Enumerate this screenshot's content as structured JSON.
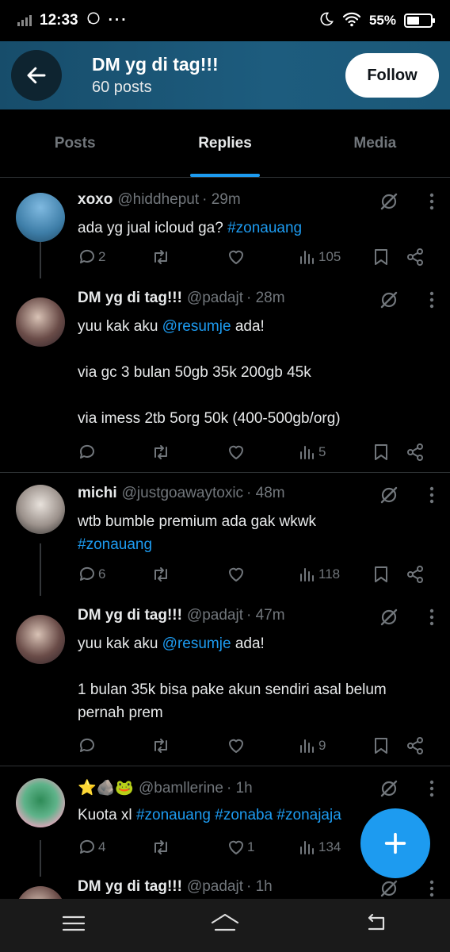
{
  "status": {
    "time": "12:33",
    "dots": "···",
    "battery": "55%",
    "battery_fraction": 0.55
  },
  "header": {
    "title": "DM yg di tag!!!",
    "subtitle": "60 posts",
    "follow_label": "Follow"
  },
  "tabs": [
    {
      "label": "Posts"
    },
    {
      "label": "Replies"
    },
    {
      "label": "Media"
    }
  ],
  "active_tab": "Replies",
  "tweets": [
    {
      "name": "xoxo",
      "handle": "@hiddheput",
      "time": "· 29m",
      "body": [
        {
          "t": "ada yg jual icloud ga? "
        },
        {
          "t": "#zonauang",
          "link": true
        }
      ],
      "replies": "2",
      "retweets": "",
      "likes": "",
      "views": "105"
    },
    {
      "name": "DM yg di tag!!!",
      "handle": "@padajt",
      "time": "· 28m",
      "body": [
        {
          "t": "yuu kak aku "
        },
        {
          "t": "@resumje",
          "link": true
        },
        {
          "t": " ada!\n\nvia gc 3 bulan 50gb 35k 200gb 45k\n\nvia imess 2tb 5org 50k (400-500gb/org)"
        }
      ],
      "replies": "",
      "retweets": "",
      "likes": "",
      "views": "5"
    },
    {
      "name": "michi",
      "handle": "@justgoawaytoxic",
      "time": "· 48m",
      "body": [
        {
          "t": "wtb bumble premium ada gak wkwk\n"
        },
        {
          "t": "#zonauang",
          "link": true
        }
      ],
      "replies": "6",
      "retweets": "",
      "likes": "",
      "views": "118"
    },
    {
      "name": "DM yg di tag!!!",
      "handle": "@padajt",
      "time": "· 47m",
      "body": [
        {
          "t": "yuu kak aku "
        },
        {
          "t": "@resumje",
          "link": true
        },
        {
          "t": " ada!\n\n1 bulan 35k bisa pake akun sendiri asal belum pernah prem"
        }
      ],
      "replies": "",
      "retweets": "",
      "likes": "",
      "views": "9"
    },
    {
      "name": "⭐🪨🐸",
      "handle": "@bamllerine",
      "time": "· 1h",
      "body": [
        {
          "t": "Kuota xl "
        },
        {
          "t": "#zonauang #zonaba #zonajaja",
          "link": true
        }
      ],
      "replies": "4",
      "retweets": "",
      "likes": "1",
      "views": "134"
    },
    {
      "name": "DM yg di tag!!!",
      "handle": "@padajt",
      "time": "· 1h",
      "body": [],
      "replies": "",
      "retweets": "",
      "likes": "",
      "views": ""
    }
  ],
  "icons": {
    "back": "arrow-left-icon",
    "reply": "reply-icon",
    "retweet": "retweet-icon",
    "like": "heart-icon",
    "views": "views-icon",
    "bookmark": "bookmark-icon",
    "share": "share-icon",
    "grok": "grok-icon",
    "more": "more-icon",
    "compose": "plus-icon"
  },
  "colors": {
    "accent": "#1d9bf0",
    "header_bg": "#1d5c7e",
    "text": "#e7e9ea",
    "muted": "#71767b",
    "bg": "#000000"
  }
}
